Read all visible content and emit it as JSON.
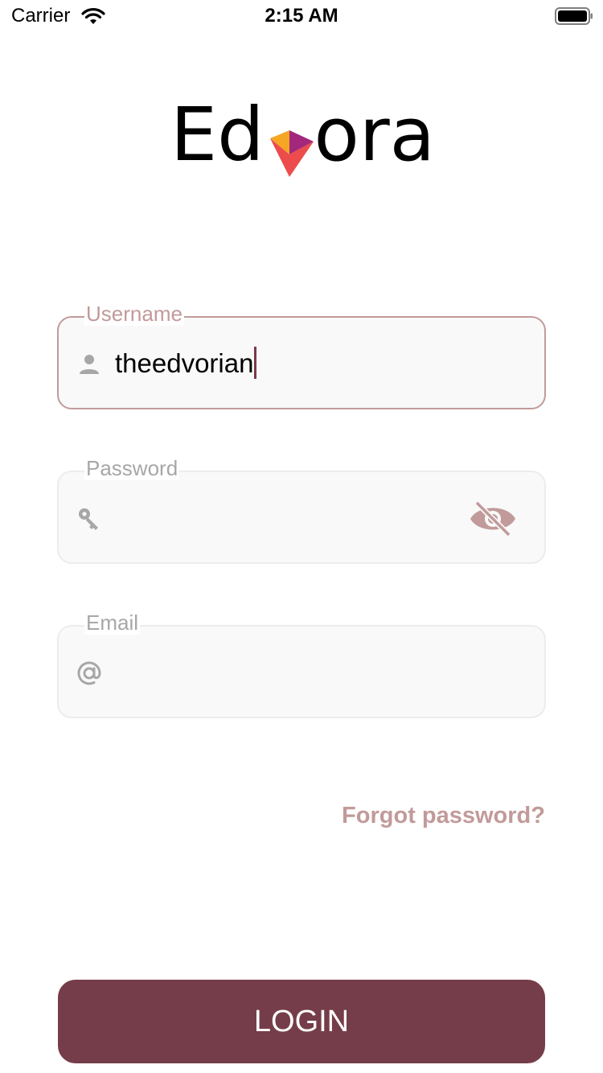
{
  "status_bar": {
    "carrier": "Carrier",
    "time": "2:15 AM",
    "wifi_icon": "wifi-icon",
    "battery_icon": "battery-icon"
  },
  "logo": {
    "text_before": "Ed",
    "text_after": "ora",
    "mark_icon": "edvora-v-mark",
    "mark_colors": [
      "#f5a623",
      "#ec4c4c",
      "#a3287c"
    ]
  },
  "form": {
    "username": {
      "label": "Username",
      "value": "theedvorian",
      "icon": "person-icon",
      "focused": true
    },
    "password": {
      "label": "Password",
      "value": "",
      "icon": "key-icon",
      "toggle_icon": "eye-off-icon"
    },
    "email": {
      "label": "Email",
      "value": "",
      "icon": "at-icon"
    }
  },
  "links": {
    "forgot_password": "Forgot password?"
  },
  "actions": {
    "login_label": "LOGIN"
  },
  "colors": {
    "accent": "#c29a9a",
    "primary": "#753d49",
    "caret": "#7a3a48",
    "field_bg": "#f9f9f9"
  }
}
